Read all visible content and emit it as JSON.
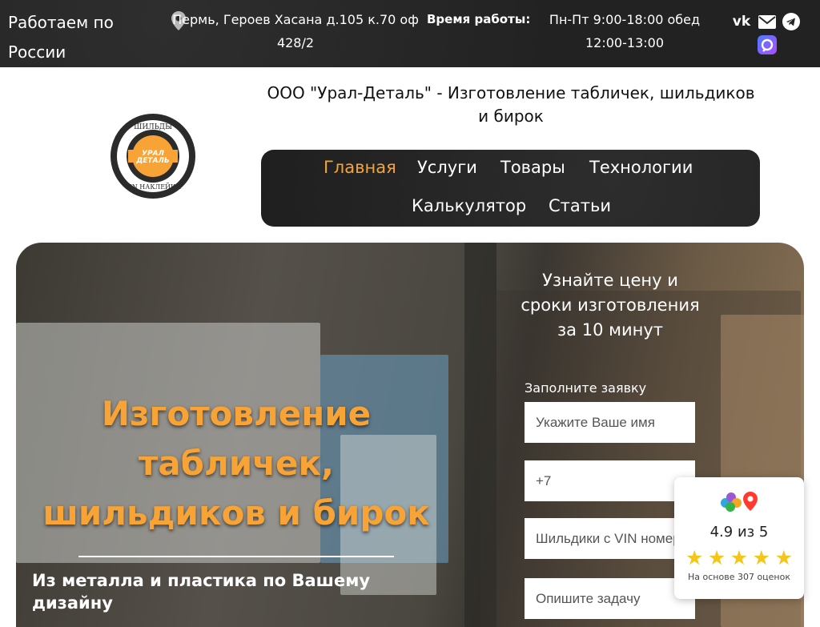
{
  "topbar": {
    "region": "Работаем по России",
    "address": "Пермь, Героев Хасана д.105 к.70 оф 428/2",
    "hours_label": "Время работы:",
    "hours": "Пн-Пт  9:00-18:00 обед 12:00-13:00",
    "vk_label": "vk"
  },
  "header": {
    "site_title": "ООО \"Урал-Деталь\" - Изготовление табличек, шильдиков и бирок",
    "logo": {
      "top_text": "ШИЛЬДЫ",
      "center_line1": "УРАЛ",
      "center_line2": "ДЕТАЛЬ",
      "bottom_text": "VIN НАКЛЕЙКИ"
    }
  },
  "nav": {
    "items": [
      {
        "label": "Главная",
        "active": true
      },
      {
        "label": "Услуги",
        "active": false
      },
      {
        "label": "Товары",
        "active": false
      },
      {
        "label": "Технологии",
        "active": false
      },
      {
        "label": "Калькулятор",
        "active": false
      },
      {
        "label": "Статьи",
        "active": false
      }
    ]
  },
  "hero": {
    "title": "Изготовление табличек, шильдиков и бирок",
    "subtitle": "Из металла и пластика по Вашему дизайну"
  },
  "form": {
    "title": "Узнайте цену и сроки изготовления за 10 минут",
    "label": "Заполните заявку",
    "name_placeholder": "Укажите Ваше имя",
    "phone_value": "+7",
    "product_value": "Шильдики с VIN номером",
    "task_placeholder": "Опишите задачу"
  },
  "rating": {
    "score": "4.9 из 5",
    "stars": 5,
    "count": "На основе 307 оценок"
  },
  "colors": {
    "accent": "#f7a335",
    "dark": "#242424",
    "star": "#f5c518"
  }
}
